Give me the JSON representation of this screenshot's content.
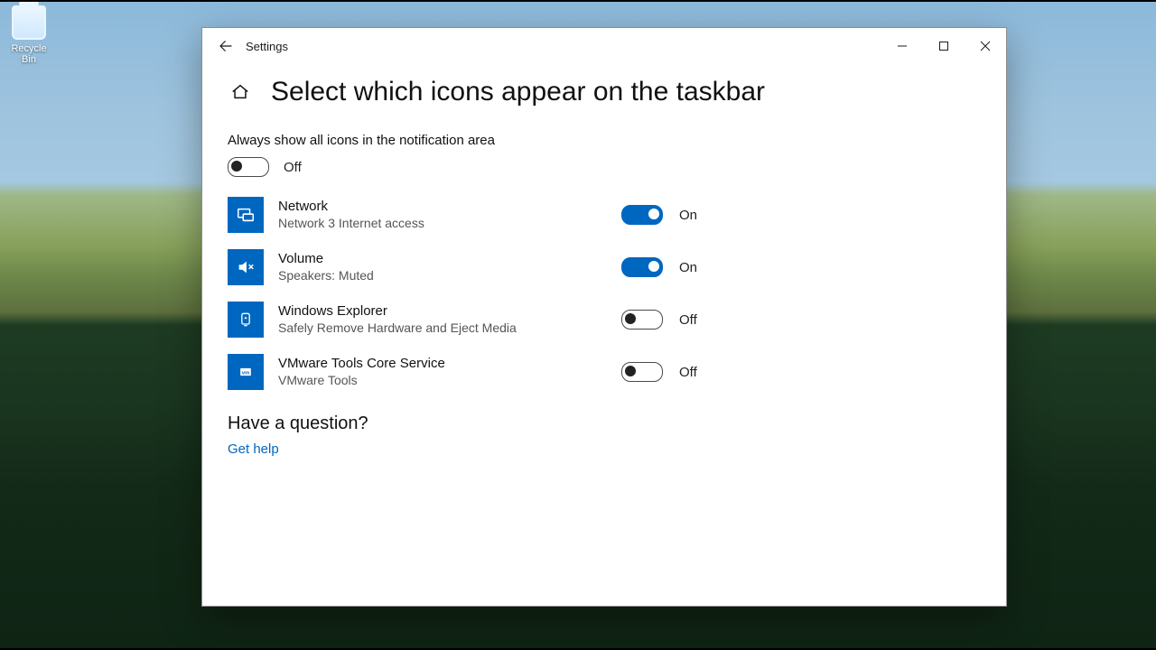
{
  "desktop": {
    "recycle_bin_label": "Recycle Bin"
  },
  "window": {
    "app_title": "Settings",
    "page_title": "Select which icons appear on the taskbar"
  },
  "master_toggle": {
    "label": "Always show all icons in the notification area",
    "state_text": "Off",
    "on": false
  },
  "items": [
    {
      "icon": "network-icon",
      "title": "Network",
      "subtitle": "Network 3 Internet access",
      "on": true,
      "state_text": "On"
    },
    {
      "icon": "volume-mute-icon",
      "title": "Volume",
      "subtitle": "Speakers: Muted",
      "on": true,
      "state_text": "On"
    },
    {
      "icon": "eject-media-icon",
      "title": "Windows Explorer",
      "subtitle": "Safely Remove Hardware and Eject Media",
      "on": false,
      "state_text": "Off"
    },
    {
      "icon": "vmware-icon",
      "title": "VMware Tools Core Service",
      "subtitle": "VMware Tools",
      "on": false,
      "state_text": "Off"
    }
  ],
  "help": {
    "heading": "Have a question?",
    "link_text": "Get help"
  },
  "colors": {
    "accent": "#0067c0"
  }
}
